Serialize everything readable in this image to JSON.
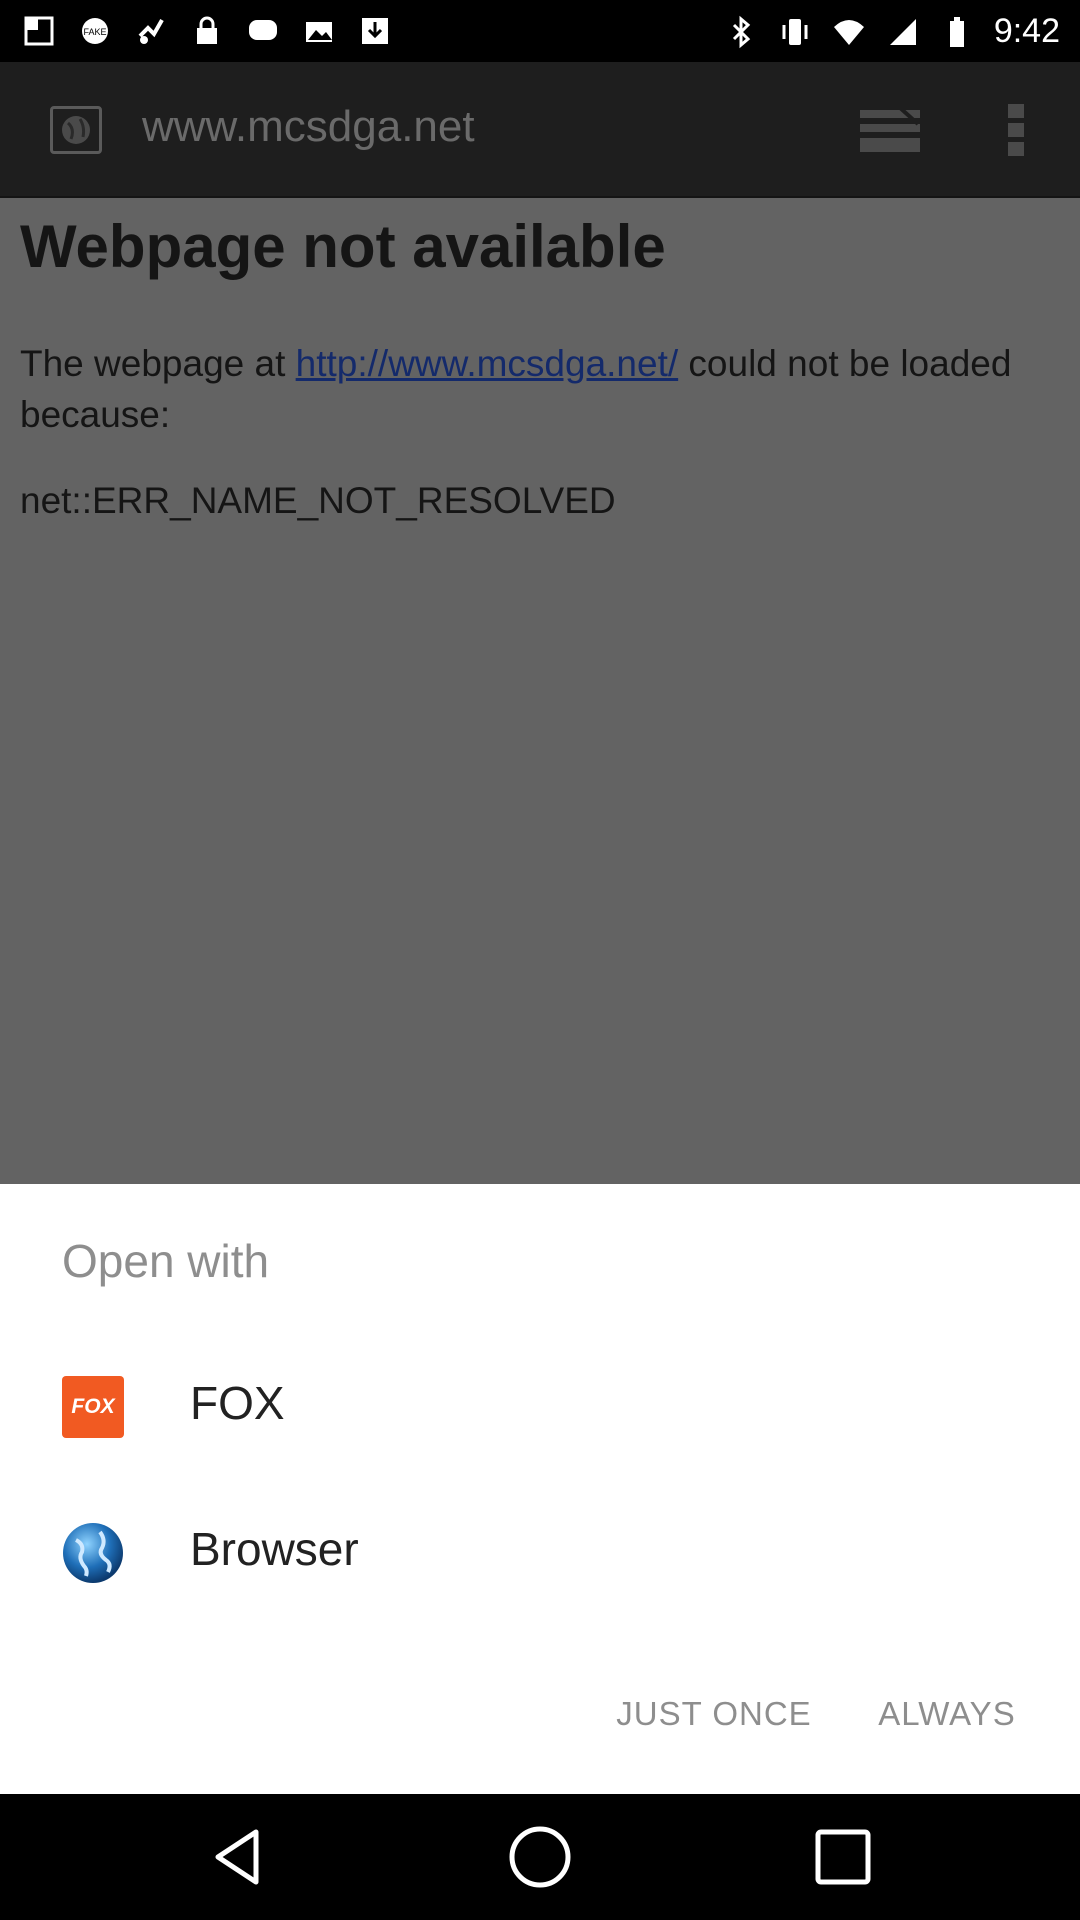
{
  "status_bar": {
    "time": "9:42",
    "left_icons": [
      "notification-icon",
      "fake-gps-icon",
      "location-icon",
      "lock-icon",
      "message-icon",
      "photos-icon",
      "download-icon"
    ],
    "right_icons": [
      "bluetooth-icon",
      "vibrate-icon",
      "wifi-icon",
      "signal-icon",
      "battery-icon"
    ]
  },
  "browser": {
    "url": "www.mcsdga.net"
  },
  "error_page": {
    "title": "Webpage not available",
    "body_prefix": "The webpage at ",
    "link": "http://www.mcsdga.net/",
    "body_suffix": " could not be loaded because:",
    "code": "net::ERR_NAME_NOT_RESOLVED"
  },
  "chooser": {
    "title": "Open with",
    "apps": [
      {
        "label": "FOX",
        "icon": "fox-app-icon",
        "icon_text": "FOX",
        "icon_color": "#f15a22"
      },
      {
        "label": "Browser",
        "icon": "globe-app-icon"
      }
    ],
    "just_once_label": "JUST ONCE",
    "always_label": "ALWAYS"
  },
  "colors": {
    "scrim": "#636363",
    "sheet": "#ffffff",
    "muted_text": "#8e8e8e",
    "fox_orange": "#f15a22"
  }
}
